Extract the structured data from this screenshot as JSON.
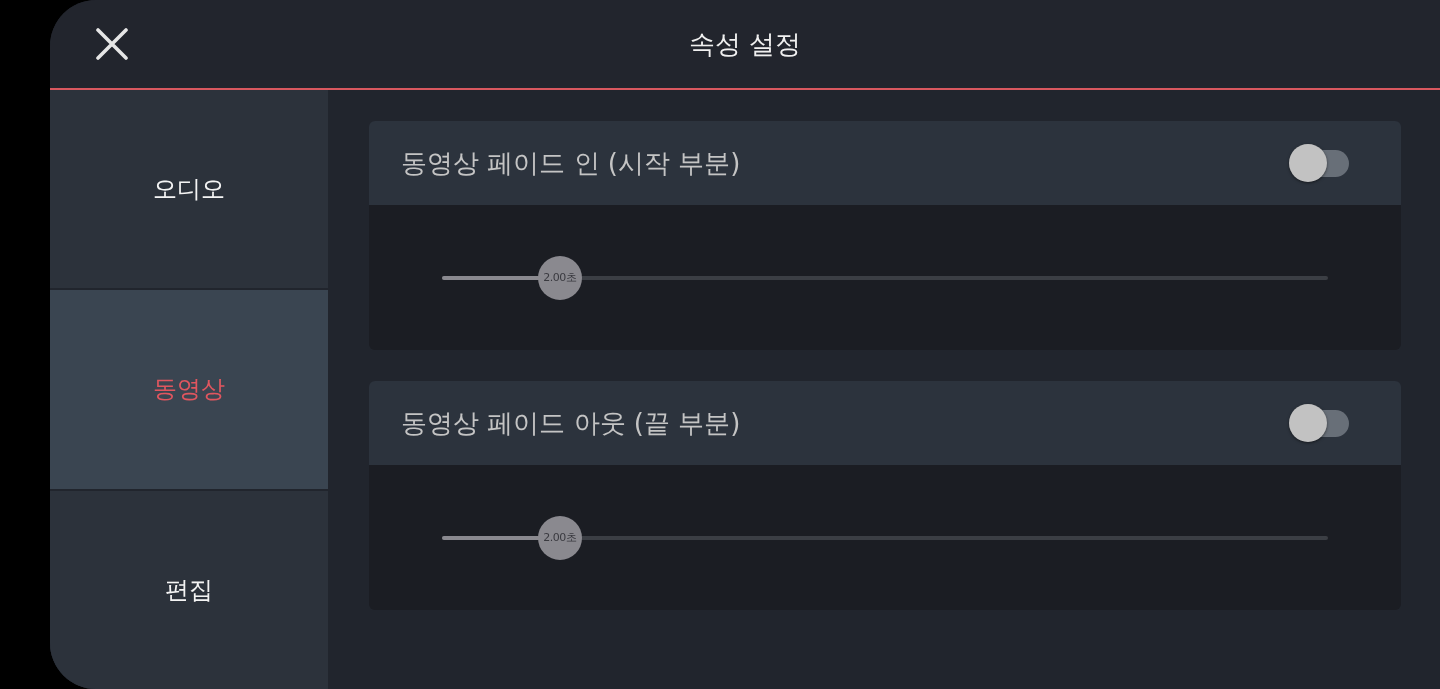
{
  "window": {
    "title": "속성 설정"
  },
  "sidebar": {
    "items": [
      {
        "label": "오디오",
        "selected": false
      },
      {
        "label": "동영상",
        "selected": true
      },
      {
        "label": "편집",
        "selected": false
      }
    ]
  },
  "settings": [
    {
      "title": "동영상 페이드 인 (시작 부분)",
      "on": false,
      "slider": {
        "level": 0.133,
        "reading": "2.00초"
      }
    },
    {
      "title": "동영상 페이드 아웃 (끝 부분)",
      "on": false,
      "slider": {
        "level": 0.133,
        "reading": "2.00초"
      }
    }
  ]
}
